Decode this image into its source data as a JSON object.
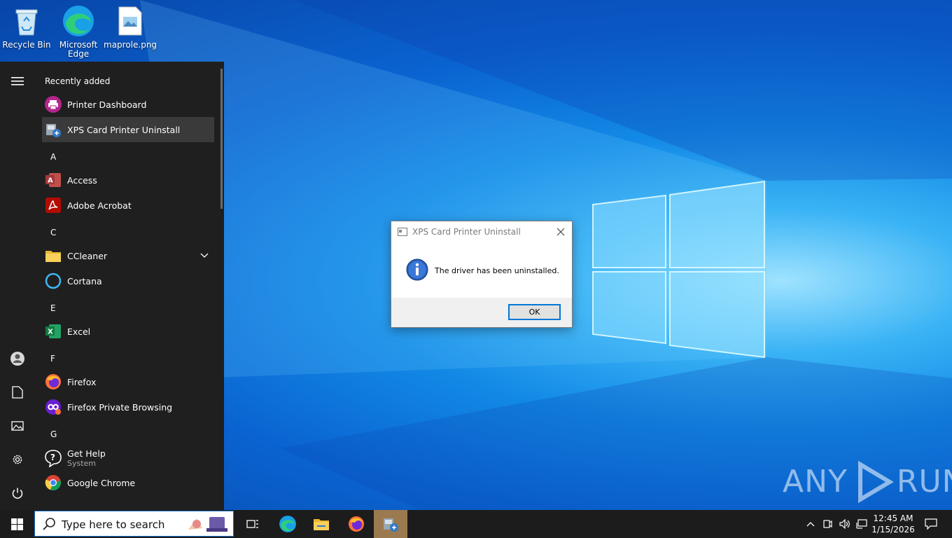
{
  "desktop": {
    "icons": [
      {
        "label": "Recycle Bin",
        "icon": "recycle-bin-icon"
      },
      {
        "label": "Microsoft Edge",
        "icon": "edge-icon"
      },
      {
        "label": "maprole.png",
        "icon": "image-file-icon"
      }
    ],
    "watermark": {
      "left": "ANY",
      "right": "RUN"
    }
  },
  "start_menu": {
    "recently_added": "Recently added",
    "recent": [
      {
        "label": "Printer Dashboard",
        "icon": "printer-dashboard-icon"
      },
      {
        "label": "XPS Card Printer Uninstall",
        "icon": "uninstall-icon"
      }
    ],
    "groups": [
      {
        "letter": "A",
        "apps": [
          {
            "label": "Access",
            "icon": "access-icon"
          },
          {
            "label": "Adobe Acrobat",
            "icon": "acrobat-icon"
          }
        ]
      },
      {
        "letter": "C",
        "apps": [
          {
            "label": "CCleaner",
            "icon": "folder-icon"
          },
          {
            "label": "Cortana",
            "icon": "cortana-icon"
          }
        ]
      },
      {
        "letter": "E",
        "apps": [
          {
            "label": "Excel",
            "icon": "excel-icon"
          }
        ]
      },
      {
        "letter": "F",
        "apps": [
          {
            "label": "Firefox",
            "icon": "firefox-icon"
          },
          {
            "label": "Firefox Private Browsing",
            "icon": "firefox-private-icon"
          }
        ]
      },
      {
        "letter": "G",
        "apps": [
          {
            "label": "Get Help",
            "sub": "System",
            "icon": "get-help-icon"
          },
          {
            "label": "Google Chrome",
            "icon": "chrome-icon"
          }
        ]
      }
    ],
    "rail_icons": [
      "hamburger-icon",
      "user-icon",
      "documents-icon",
      "pictures-icon",
      "settings-icon",
      "power-icon"
    ]
  },
  "dialog": {
    "title": "XPS Card Printer Uninstall",
    "message": "The driver has been uninstalled.",
    "ok_label": "OK"
  },
  "taskbar": {
    "search_placeholder": "Type here to search",
    "time": "12:45 AM",
    "date": "1/15/2026",
    "accent": "#0078d7"
  }
}
